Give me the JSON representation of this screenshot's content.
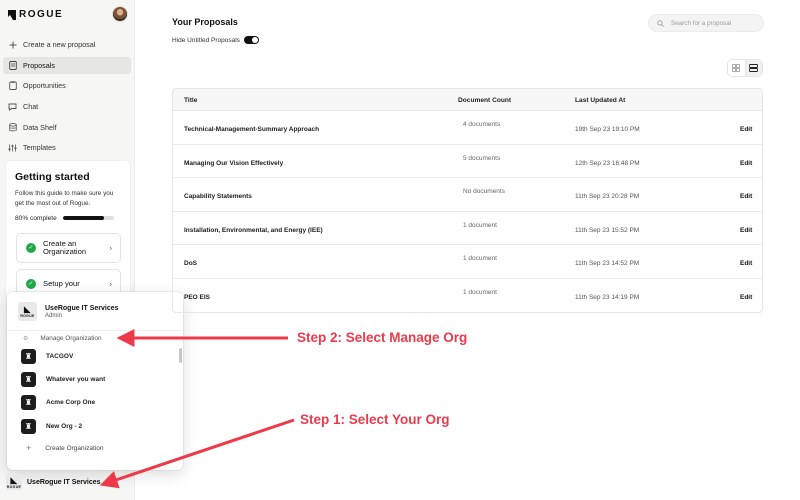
{
  "app": {
    "logo_text": "ROGUE"
  },
  "sidebar": {
    "items": [
      {
        "label": "Create a new proposal",
        "icon": "plus-icon"
      },
      {
        "label": "Proposals",
        "icon": "document-icon",
        "active": true
      },
      {
        "label": "Opportunities",
        "icon": "clipboard-icon"
      },
      {
        "label": "Chat",
        "icon": "chat-icon"
      },
      {
        "label": "Data Shelf",
        "icon": "database-icon"
      },
      {
        "label": "Templates",
        "icon": "sliders-icon"
      }
    ],
    "guide": {
      "title": "Getting started",
      "description": "Follow this guide to make sure you get the most out of Rogue.",
      "progress_label": "80% complete",
      "progress": 0.8,
      "steps": [
        {
          "label": "Create an Organization",
          "done": true
        },
        {
          "label": "Setup your",
          "done": true
        }
      ]
    },
    "org_menu": {
      "current": {
        "name": "UseRogue IT Services",
        "role": "Admin",
        "logo_text": "ROGUE"
      },
      "manage_label": "Manage Organization",
      "orgs": [
        "TACGOV",
        "Whatever you want",
        "Acme Corp One",
        "New Org - 2"
      ],
      "create_label": "Create Organization"
    },
    "org_switcher": {
      "name": "UseRogue IT Services",
      "logo_text": "ROGUE"
    }
  },
  "main": {
    "title": "Your Proposals",
    "hide_untitled_label": "Hide Untitled Proposals",
    "hide_untitled_on": true,
    "search": {
      "placeholder": "Search for a proposal"
    },
    "table": {
      "headers": {
        "title": "Title",
        "count": "Document Count",
        "updated": "Last Updated At"
      },
      "rows": [
        {
          "title": "Technical-Management-Summary Approach",
          "count": "4 documents",
          "updated": "19th Sep 23 19:10 PM",
          "action": "Edit"
        },
        {
          "title": "Managing Our Vision Effectively",
          "count": "5 documents",
          "updated": "12th Sep 23 16:48 PM",
          "action": "Edit"
        },
        {
          "title": "Capability Statements",
          "count": "No documents",
          "updated": "11th Sep 23 20:28 PM",
          "action": "Edit"
        },
        {
          "title": "Installation, Environmental, and Energy (IEE)",
          "count": "1 document",
          "updated": "11th Sep 23 15:52 PM",
          "action": "Edit"
        },
        {
          "title": "DoS",
          "count": "1 document",
          "updated": "11th Sep 23 14:52 PM",
          "action": "Edit"
        },
        {
          "title": "PEO EIS",
          "count": "1 document",
          "updated": "11th Sep 23 14:19 PM",
          "action": "Edit"
        }
      ]
    }
  },
  "annotations": {
    "step2": "Step 2: Select Manage Org",
    "step1": "Step 1: Select Your Org",
    "color": "#ec3a4b"
  }
}
